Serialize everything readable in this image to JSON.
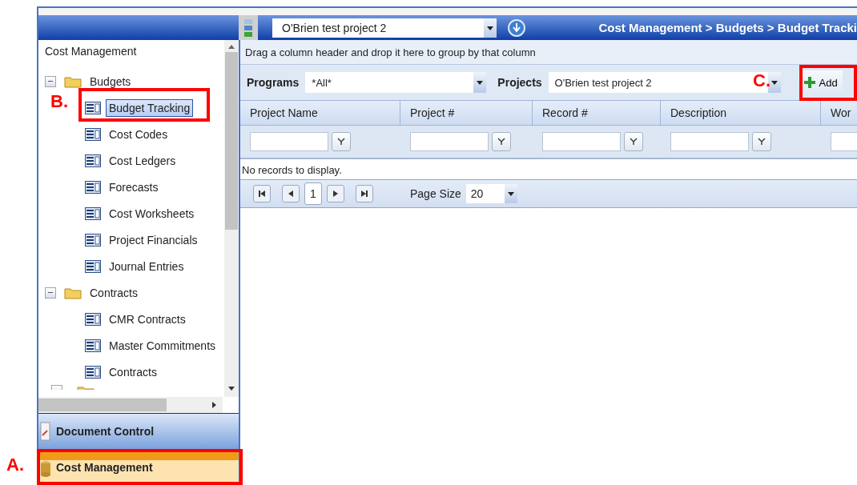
{
  "header": {
    "project": "O'Brien test project 2",
    "breadcrumb": "Cost Management > Budgets > Budget Tracki"
  },
  "sidebar": {
    "title": "Cost Management",
    "tree": [
      {
        "label": "Budgets",
        "kind": "folder",
        "expanded": true,
        "children": [
          {
            "label": "Budget Tracking",
            "kind": "page",
            "selected": true
          },
          {
            "label": "Cost Codes",
            "kind": "page",
            "selected": false
          },
          {
            "label": "Cost Ledgers",
            "kind": "page",
            "selected": false
          },
          {
            "label": "Forecasts",
            "kind": "page",
            "selected": false
          },
          {
            "label": "Cost Worksheets",
            "kind": "page",
            "selected": false
          },
          {
            "label": "Project Financials",
            "kind": "page",
            "selected": false
          },
          {
            "label": "Journal Entries",
            "kind": "page",
            "selected": false
          }
        ]
      },
      {
        "label": "Contracts",
        "kind": "folder",
        "expanded": true,
        "children": [
          {
            "label": "CMR Contracts",
            "kind": "page",
            "selected": false
          },
          {
            "label": "Master Commitments",
            "kind": "page",
            "selected": false
          },
          {
            "label": "Contracts",
            "kind": "page",
            "selected": false
          }
        ]
      }
    ],
    "modules": [
      {
        "label": "Document Control",
        "selected": false
      },
      {
        "label": "Cost Management",
        "selected": true
      }
    ]
  },
  "grid": {
    "group_hint": "Drag a column header and drop it here to group by that column",
    "programs_label": "Programs",
    "programs_value": "*All*",
    "projects_label": "Projects",
    "projects_value": "O'Brien test project 2",
    "add_button": "Add",
    "columns": [
      "Project Name",
      "Project #",
      "Record #",
      "Description",
      "Wor"
    ],
    "empty_message": "No records to display.",
    "page": "1",
    "page_size_label": "Page Size",
    "page_size": "20"
  },
  "callouts": [
    {
      "label": "A."
    },
    {
      "label": "B."
    },
    {
      "label": "C."
    }
  ]
}
